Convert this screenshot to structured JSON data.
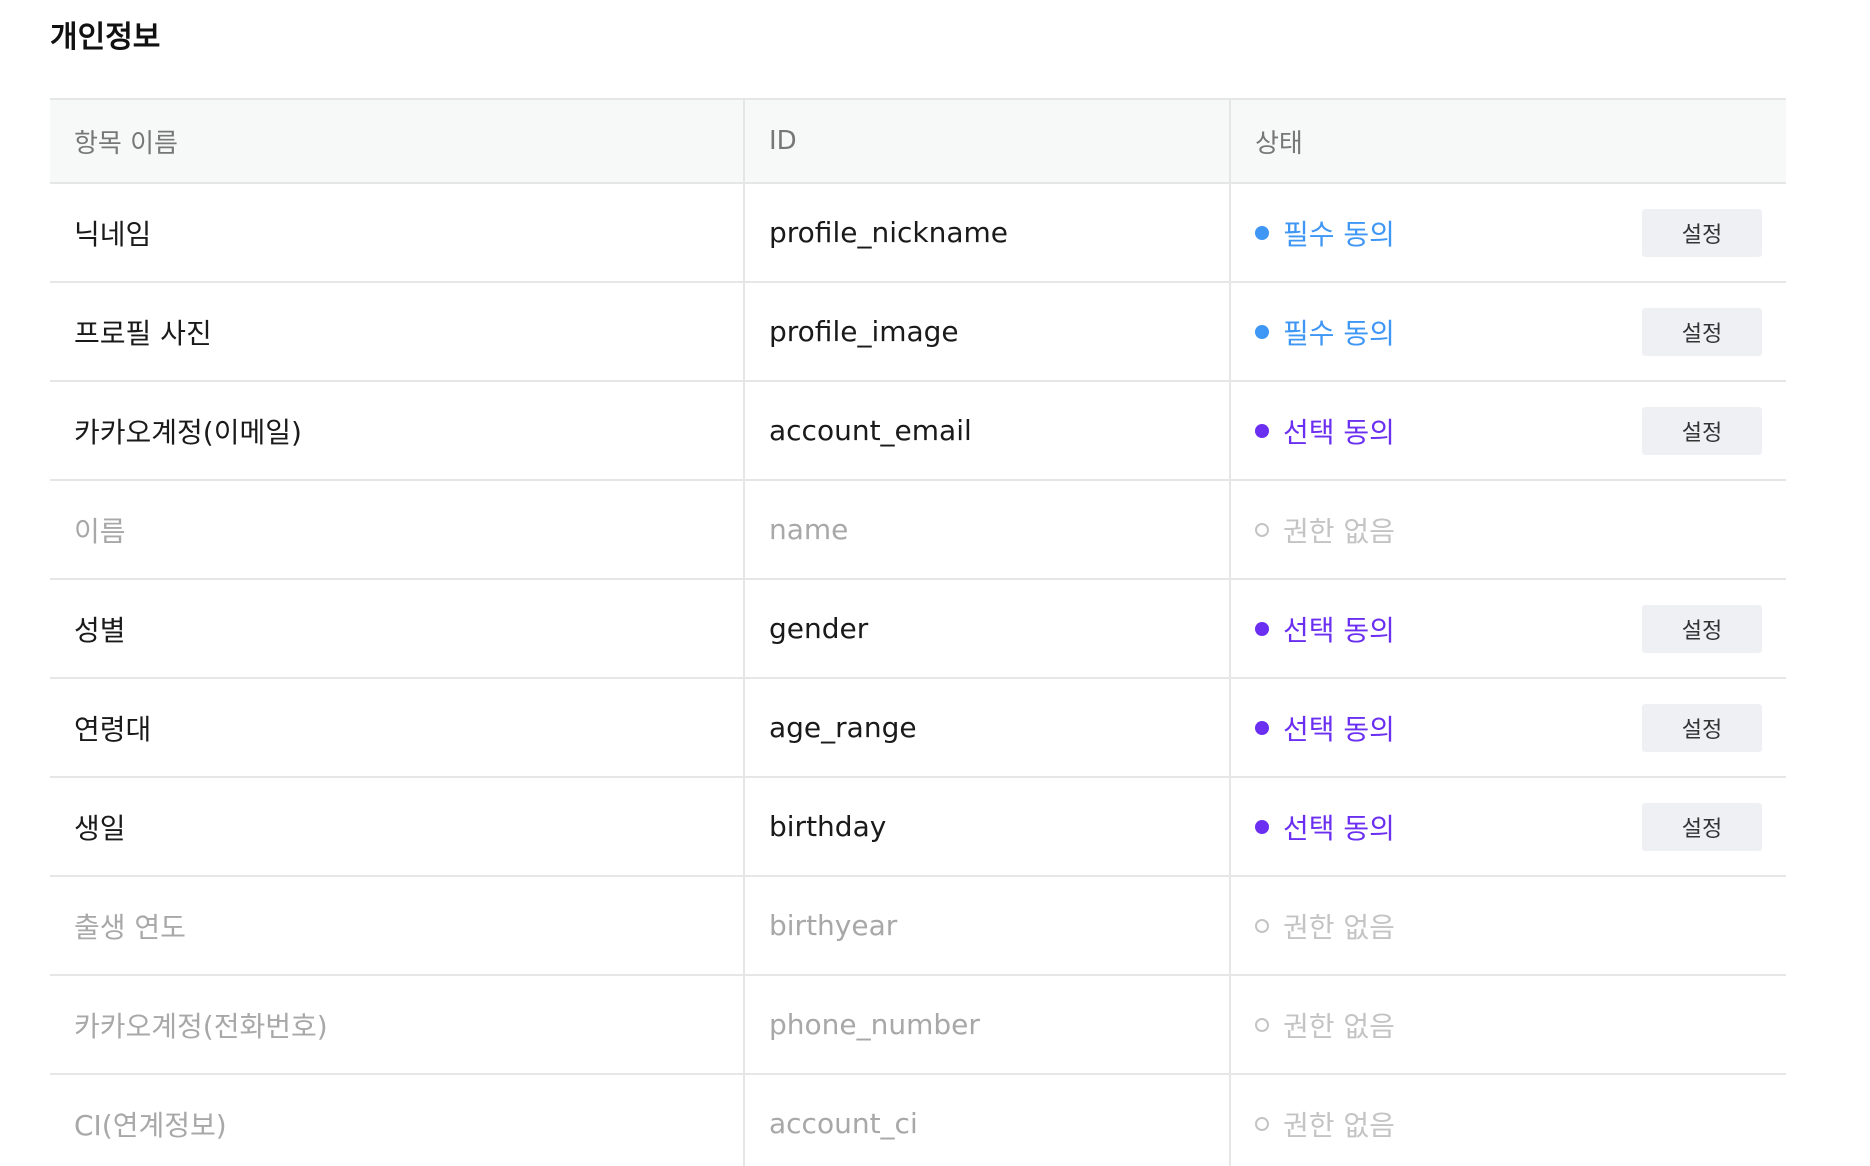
{
  "section": {
    "title": "개인정보"
  },
  "table": {
    "headers": {
      "name": "항목 이름",
      "id": "ID",
      "status": "상태"
    },
    "button_label": "설정",
    "status_colors": {
      "required": "#3e96f5",
      "optional": "#6a2ff0",
      "none": "#c4c4c4"
    },
    "rows": [
      {
        "name": "닉네임",
        "id": "profile_nickname",
        "status": "필수 동의",
        "type": "required",
        "has_button": true
      },
      {
        "name": "프로필 사진",
        "id": "profile_image",
        "status": "필수 동의",
        "type": "required",
        "has_button": true
      },
      {
        "name": "카카오계정(이메일)",
        "id": "account_email",
        "status": "선택 동의",
        "type": "optional",
        "has_button": true
      },
      {
        "name": "이름",
        "id": "name",
        "status": "권한 없음",
        "type": "none",
        "has_button": false
      },
      {
        "name": "성별",
        "id": "gender",
        "status": "선택 동의",
        "type": "optional",
        "has_button": true
      },
      {
        "name": "연령대",
        "id": "age_range",
        "status": "선택 동의",
        "type": "optional",
        "has_button": true
      },
      {
        "name": "생일",
        "id": "birthday",
        "status": "선택 동의",
        "type": "optional",
        "has_button": true
      },
      {
        "name": "출생 연도",
        "id": "birthyear",
        "status": "권한 없음",
        "type": "none",
        "has_button": false
      },
      {
        "name": "카카오계정(전화번호)",
        "id": "phone_number",
        "status": "권한 없음",
        "type": "none",
        "has_button": false
      },
      {
        "name": "CI(연계정보)",
        "id": "account_ci",
        "status": "권한 없음",
        "type": "none",
        "has_button": false
      }
    ]
  }
}
